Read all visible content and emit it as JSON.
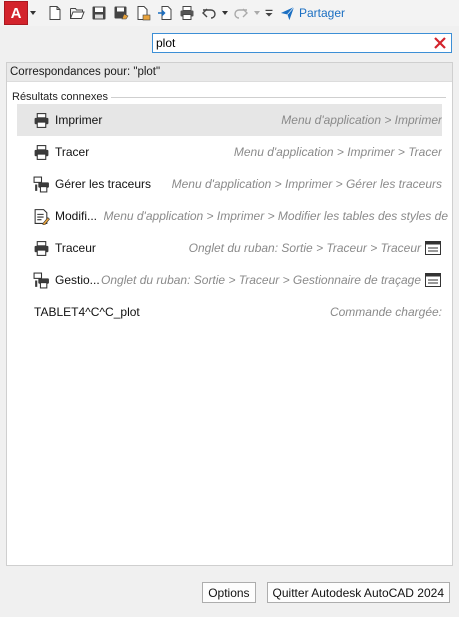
{
  "toolbar": {
    "app_button_letter": "A",
    "share_label": "Partager",
    "accent_color": "#1b6fc2",
    "app_color": "#d3232c",
    "icons": [
      "new-icon",
      "open-icon",
      "save-icon",
      "save-as-icon",
      "export-icon",
      "import-icon",
      "print-icon",
      "undo-icon",
      "redo-icon",
      "customize-icon",
      "share-icon"
    ]
  },
  "search": {
    "value": "plot"
  },
  "results": {
    "matches_header": "Correspondances pour: \"plot\"",
    "section_title": "Résultats connexes",
    "items": [
      {
        "label": "Imprimer",
        "path": "Menu d'application > Imprimer",
        "icon": "printer-icon",
        "selected": true
      },
      {
        "label": "Tracer",
        "path": "Menu d'application > Imprimer > Tracer",
        "icon": "printer-icon"
      },
      {
        "label": "Gérer les traceurs",
        "path": "Menu d'application > Imprimer > Gérer les traceurs",
        "icon": "plotter-manager-icon"
      },
      {
        "label": "Modifi...",
        "path": "Menu d'application > Imprimer > Modifier les tables des styles de",
        "icon": "plot-style-icon"
      },
      {
        "label": "Traceur",
        "path": "Onglet du ruban: Sortie > Traceur > Traceur",
        "icon": "printer-icon",
        "trail_icon": "ribbon-panel-icon"
      },
      {
        "label": "Gestio...",
        "path": "Onglet du ruban: Sortie > Traceur > Gestionnaire de traçage",
        "icon": "plotter-manager-icon",
        "trail_icon": "ribbon-panel-icon"
      },
      {
        "label": "TABLET4^C^C_plot",
        "path": "Commande chargée:",
        "icon": ""
      }
    ]
  },
  "footer": {
    "options_label": "Options",
    "quit_label": "Quitter Autodesk AutoCAD 2024"
  }
}
